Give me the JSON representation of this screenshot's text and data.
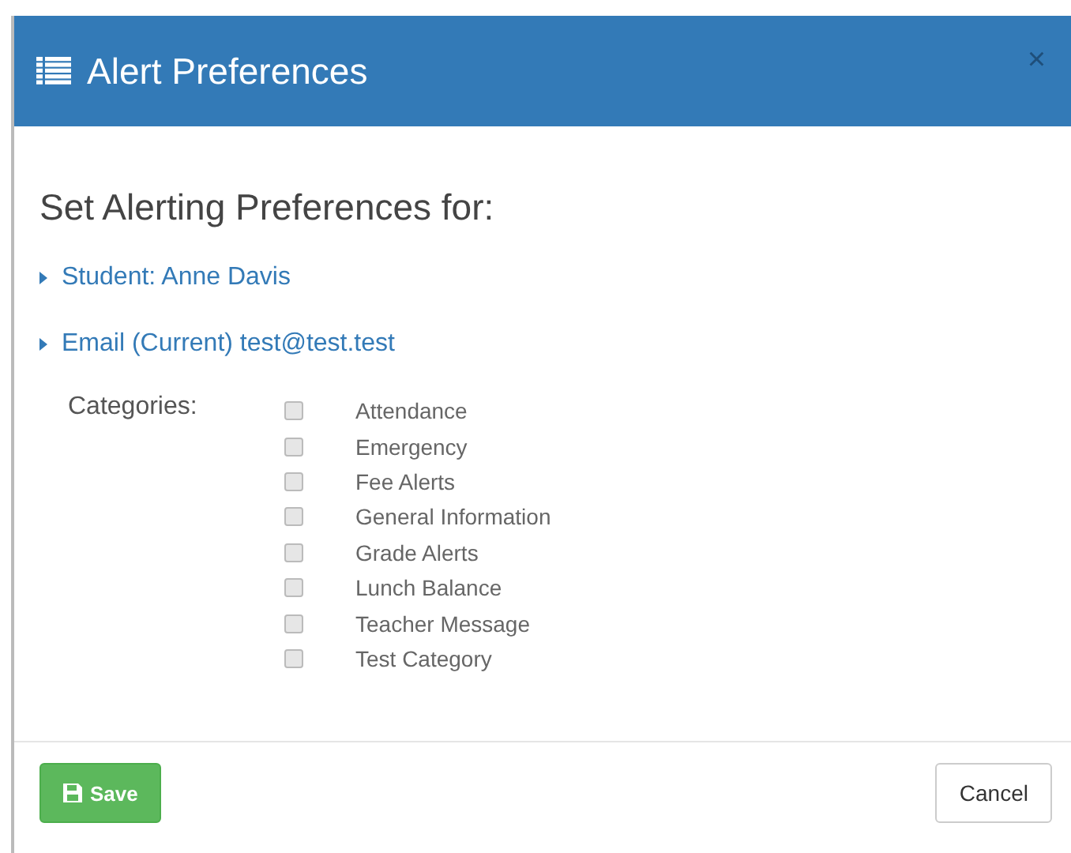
{
  "dialog": {
    "title": "Alert Preferences",
    "close": "×"
  },
  "heading": "Set Alerting Preferences for:",
  "toggles": [
    {
      "label": "Student: Anne Davis",
      "expanded": false
    },
    {
      "label": "Email (Current) test@test.test",
      "expanded": false
    }
  ],
  "categories_label": "Categories:",
  "categories": [
    {
      "label": "Attendance",
      "checked": false
    },
    {
      "label": "Emergency",
      "checked": false
    },
    {
      "label": "Fee Alerts",
      "checked": false
    },
    {
      "label": "General Information",
      "checked": false
    },
    {
      "label": "Grade Alerts",
      "checked": false
    },
    {
      "label": "Lunch Balance",
      "checked": false
    },
    {
      "label": "Teacher Message",
      "checked": false
    },
    {
      "label": "Test Category",
      "checked": false
    }
  ],
  "buttons": {
    "save": "Save",
    "cancel": "Cancel"
  }
}
